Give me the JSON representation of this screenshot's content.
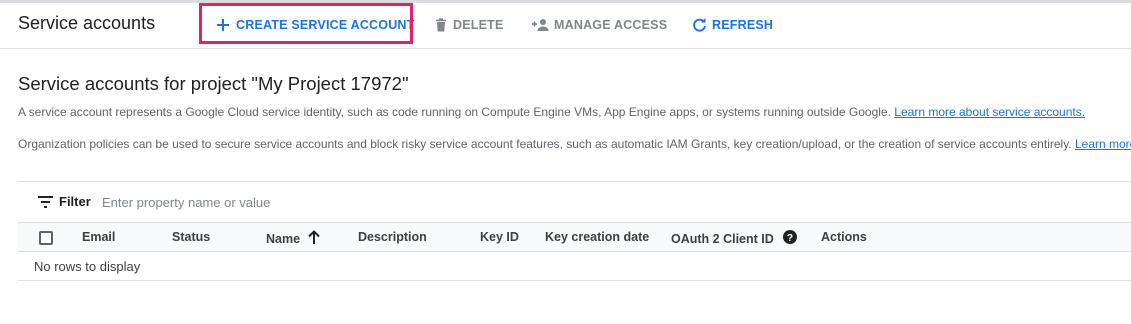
{
  "header": {
    "title": "Service accounts",
    "toolbar": {
      "create_label": "CREATE SERVICE ACCOUNT",
      "delete_label": "DELETE",
      "manage_access_label": "MANAGE ACCESS",
      "refresh_label": "REFRESH"
    }
  },
  "main": {
    "title": "Service accounts for project \"My Project 17972\"",
    "description_1": "A service account represents a Google Cloud service identity, such as code running on Compute Engine VMs, App Engine apps, or systems running outside Google.",
    "description_1_link": "Learn more about service accounts.",
    "description_2": "Organization policies can be used to secure service accounts and block risky service account features, such as automatic IAM Grants, key creation/upload, or the creation of service accounts entirely.",
    "description_2_link": "Learn more"
  },
  "filter": {
    "label": "Filter",
    "placeholder": "Enter property name or value"
  },
  "table": {
    "columns": {
      "email": "Email",
      "status": "Status",
      "name": "Name",
      "description": "Description",
      "key_id": "Key ID",
      "key_creation_date": "Key creation date",
      "oauth_client_id": "OAuth 2 Client ID",
      "actions": "Actions"
    },
    "sort_column": "Name",
    "sort_direction": "ascending",
    "empty_text": "No rows to display"
  },
  "colors": {
    "accent": "#1a73e8",
    "highlight_box": "#e0245e",
    "disabled_text": "#80868b"
  },
  "icons": [
    "add-icon",
    "delete-icon",
    "person-add-icon",
    "refresh-icon",
    "filter-list-icon",
    "arrow-upward-icon",
    "help-icon",
    "checkbox-icon"
  ]
}
